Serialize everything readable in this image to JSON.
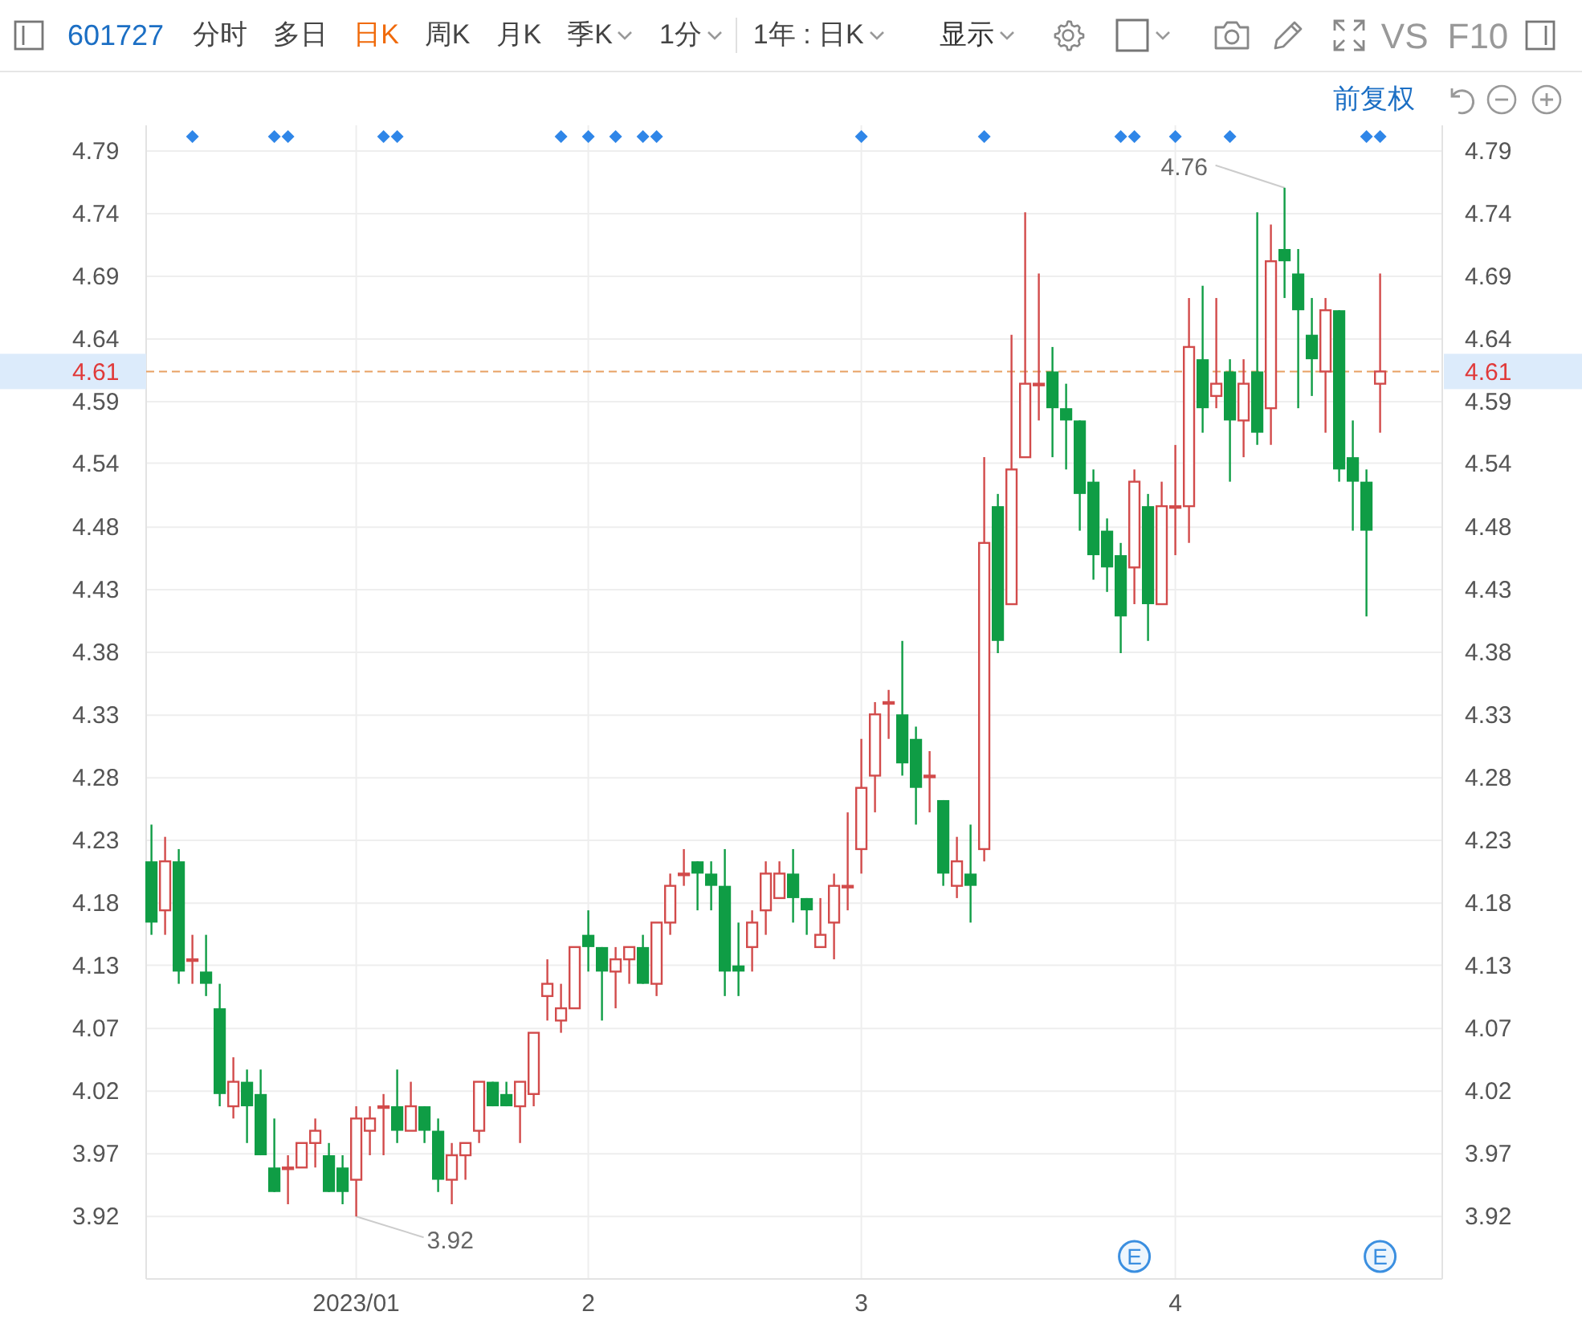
{
  "toolbar": {
    "stock_code": "601727",
    "tabs": [
      {
        "label": "分时",
        "selected": false,
        "dropdown": false
      },
      {
        "label": "多日",
        "selected": false,
        "dropdown": false
      },
      {
        "label": "日K",
        "selected": true,
        "dropdown": false
      },
      {
        "label": "周K",
        "selected": false,
        "dropdown": false
      },
      {
        "label": "月K",
        "selected": false,
        "dropdown": false
      },
      {
        "label": "季K",
        "selected": false,
        "dropdown": true
      },
      {
        "label": "1分",
        "selected": false,
        "dropdown": true
      }
    ],
    "range": "1年 : 日K",
    "display": "显示",
    "compare": "VS",
    "f10": "F10"
  },
  "subbar": {
    "adjust": "前复权"
  },
  "chart": {
    "chart_data": {
      "type": "candlestick",
      "grid": true,
      "ylim": [
        3.869,
        4.811
      ],
      "categories": [
        null,
        null,
        null,
        null,
        null,
        null,
        null,
        null,
        null,
        null,
        null,
        null,
        null,
        null,
        null,
        "2023/01",
        null,
        null,
        null,
        null,
        null,
        null,
        null,
        null,
        null,
        null,
        null,
        null,
        null,
        null,
        null,
        null,
        "2",
        null,
        null,
        null,
        null,
        null,
        null,
        null,
        null,
        null,
        null,
        null,
        null,
        null,
        null,
        null,
        null,
        null,
        null,
        null,
        "3",
        null,
        null,
        null,
        null,
        null,
        null,
        null,
        null,
        null,
        null,
        null,
        null,
        null,
        null,
        null,
        null,
        null,
        null,
        null,
        null,
        null,
        null,
        "4",
        null,
        null,
        null,
        null,
        null,
        null,
        null,
        null,
        null,
        null,
        null,
        null,
        null,
        null,
        null
      ],
      "ohlc": [
        [
          4.21,
          4.24,
          4.15,
          4.16
        ],
        [
          4.17,
          4.23,
          4.15,
          4.21
        ],
        [
          4.21,
          4.22,
          4.11,
          4.12
        ],
        [
          4.13,
          4.15,
          4.11,
          4.13
        ],
        [
          4.12,
          4.15,
          4.1,
          4.11
        ],
        [
          4.09,
          4.11,
          4.01,
          4.02
        ],
        [
          4.01,
          4.05,
          4.0,
          4.03
        ],
        [
          4.03,
          4.04,
          3.98,
          4.01
        ],
        [
          4.02,
          4.04,
          3.97,
          3.97
        ],
        [
          3.96,
          4.0,
          3.94,
          3.94
        ],
        [
          3.96,
          3.97,
          3.93,
          3.96
        ],
        [
          3.96,
          3.98,
          3.96,
          3.98
        ],
        [
          3.98,
          4.0,
          3.96,
          3.99
        ],
        [
          3.97,
          3.98,
          3.94,
          3.94
        ],
        [
          3.96,
          3.97,
          3.93,
          3.94
        ],
        [
          3.95,
          4.01,
          3.92,
          4.0
        ],
        [
          3.99,
          4.01,
          3.97,
          4.0
        ],
        [
          4.01,
          4.02,
          3.97,
          4.01
        ],
        [
          4.01,
          4.04,
          3.98,
          3.99
        ],
        [
          3.99,
          4.03,
          3.99,
          4.01
        ],
        [
          4.01,
          4.01,
          3.98,
          3.99
        ],
        [
          3.99,
          4.0,
          3.94,
          3.95
        ],
        [
          3.95,
          3.98,
          3.93,
          3.97
        ],
        [
          3.97,
          3.98,
          3.95,
          3.98
        ],
        [
          3.99,
          4.03,
          3.98,
          4.03
        ],
        [
          4.03,
          4.03,
          4.01,
          4.01
        ],
        [
          4.02,
          4.03,
          4.01,
          4.01
        ],
        [
          4.01,
          4.03,
          3.98,
          4.03
        ],
        [
          4.02,
          4.07,
          4.01,
          4.07
        ],
        [
          4.1,
          4.13,
          4.08,
          4.11
        ],
        [
          4.08,
          4.11,
          4.07,
          4.09
        ],
        [
          4.09,
          4.14,
          4.09,
          4.14
        ],
        [
          4.15,
          4.17,
          4.12,
          4.14
        ],
        [
          4.14,
          4.14,
          4.08,
          4.12
        ],
        [
          4.12,
          4.14,
          4.09,
          4.13
        ],
        [
          4.13,
          4.14,
          4.11,
          4.14
        ],
        [
          4.14,
          4.15,
          4.11,
          4.11
        ],
        [
          4.11,
          4.16,
          4.1,
          4.16
        ],
        [
          4.16,
          4.2,
          4.15,
          4.19
        ],
        [
          4.2,
          4.22,
          4.19,
          4.2
        ],
        [
          4.21,
          4.21,
          4.17,
          4.2
        ],
        [
          4.2,
          4.21,
          4.17,
          4.19
        ],
        [
          4.19,
          4.22,
          4.1,
          4.12
        ],
        [
          4.125,
          4.16,
          4.1,
          4.12
        ],
        [
          4.14,
          4.17,
          4.12,
          4.16
        ],
        [
          4.17,
          4.21,
          4.15,
          4.2
        ],
        [
          4.18,
          4.21,
          4.18,
          4.2
        ],
        [
          4.2,
          4.22,
          4.16,
          4.18
        ],
        [
          4.18,
          4.18,
          4.15,
          4.17
        ],
        [
          4.14,
          4.18,
          4.14,
          4.15
        ],
        [
          4.16,
          4.2,
          4.13,
          4.19
        ],
        [
          4.19,
          4.25,
          4.17,
          4.19
        ],
        [
          4.22,
          4.31,
          4.2,
          4.27
        ],
        [
          4.28,
          4.34,
          4.25,
          4.33
        ],
        [
          4.34,
          4.35,
          4.31,
          4.34
        ],
        [
          4.33,
          4.39,
          4.28,
          4.29
        ],
        [
          4.31,
          4.32,
          4.24,
          4.27
        ],
        [
          4.28,
          4.3,
          4.25,
          4.28
        ],
        [
          4.26,
          4.26,
          4.19,
          4.2
        ],
        [
          4.19,
          4.23,
          4.18,
          4.21
        ],
        [
          4.2,
          4.24,
          4.16,
          4.19
        ],
        [
          4.22,
          4.54,
          4.21,
          4.47
        ],
        [
          4.5,
          4.51,
          4.38,
          4.39
        ],
        [
          4.42,
          4.64,
          4.42,
          4.53
        ],
        [
          4.54,
          4.74,
          4.54,
          4.6
        ],
        [
          4.6,
          4.69,
          4.57,
          4.6
        ],
        [
          4.61,
          4.63,
          4.54,
          4.58
        ],
        [
          4.58,
          4.6,
          4.53,
          4.57
        ],
        [
          4.57,
          4.57,
          4.48,
          4.51
        ],
        [
          4.52,
          4.53,
          4.44,
          4.46
        ],
        [
          4.48,
          4.49,
          4.43,
          4.45
        ],
        [
          4.46,
          4.47,
          4.38,
          4.41
        ],
        [
          4.45,
          4.53,
          4.42,
          4.52
        ],
        [
          4.5,
          4.51,
          4.39,
          4.42
        ],
        [
          4.42,
          4.52,
          4.42,
          4.5
        ],
        [
          4.5,
          4.55,
          4.46,
          4.5
        ],
        [
          4.5,
          4.67,
          4.47,
          4.63
        ],
        [
          4.62,
          4.68,
          4.56,
          4.58
        ],
        [
          4.59,
          4.67,
          4.58,
          4.6
        ],
        [
          4.61,
          4.62,
          4.52,
          4.57
        ],
        [
          4.57,
          4.62,
          4.54,
          4.6
        ],
        [
          4.61,
          4.74,
          4.55,
          4.56
        ],
        [
          4.58,
          4.73,
          4.55,
          4.7
        ],
        [
          4.71,
          4.76,
          4.67,
          4.7
        ],
        [
          4.69,
          4.71,
          4.58,
          4.66
        ],
        [
          4.64,
          4.67,
          4.59,
          4.62
        ],
        [
          4.61,
          4.67,
          4.56,
          4.66
        ],
        [
          4.66,
          4.66,
          4.52,
          4.53
        ],
        [
          4.54,
          4.57,
          4.48,
          4.52
        ],
        [
          4.52,
          4.53,
          4.41,
          4.48
        ],
        [
          4.6,
          4.69,
          4.56,
          4.61
        ]
      ],
      "yticks": [
        {
          "value": 4.79,
          "label": "4.79"
        },
        {
          "value": 4.7388,
          "label": "4.74"
        },
        {
          "value": 4.6877,
          "label": "4.69"
        },
        {
          "value": 4.6365,
          "label": "4.64"
        },
        {
          "value": 4.5853,
          "label": "4.59"
        },
        {
          "value": 4.5351,
          "label": "4.54"
        },
        {
          "value": 4.4829,
          "label": "4.48"
        },
        {
          "value": 4.4318,
          "label": "4.43"
        },
        {
          "value": 4.3806,
          "label": "4.38"
        },
        {
          "value": 4.3294,
          "label": "4.33"
        },
        {
          "value": 4.2782,
          "label": "4.28"
        },
        {
          "value": 4.2271,
          "label": "4.23"
        },
        {
          "value": 4.1759,
          "label": "4.18"
        },
        {
          "value": 4.1251,
          "label": "4.13"
        },
        {
          "value": 4.0735,
          "label": "4.07"
        },
        {
          "value": 4.0224,
          "label": "4.02"
        },
        {
          "value": 3.9712,
          "label": "3.97"
        },
        {
          "value": 3.92,
          "label": "3.92"
        }
      ],
      "ref_lines": [
        {
          "axis": "y",
          "value": 4.61,
          "label": "4.61"
        }
      ]
    },
    "candle_notes": [
      {
        "diamond": false
      },
      {
        "diamond": false
      },
      {
        "diamond": false
      },
      {
        "diamond": true
      },
      {
        "diamond": false
      },
      {
        "diamond": false
      },
      {
        "diamond": false
      },
      {
        "diamond": false
      },
      {
        "diamond": false
      },
      {
        "diamond": true
      },
      {
        "diamond": true
      },
      {
        "diamond": false
      },
      {
        "diamond": false
      },
      {
        "diamond": false
      },
      {
        "diamond": false
      },
      {
        "diamond": false,
        "low_label": "3.92"
      },
      {
        "diamond": false
      },
      {
        "diamond": true
      },
      {
        "diamond": true
      },
      {
        "diamond": false
      },
      {
        "diamond": false
      },
      {
        "diamond": false
      },
      {
        "diamond": false
      },
      {
        "diamond": false
      },
      {
        "diamond": false
      },
      {
        "diamond": false
      },
      {
        "diamond": false
      },
      {
        "diamond": false
      },
      {
        "diamond": false
      },
      {
        "diamond": false
      },
      {
        "diamond": true
      },
      {
        "diamond": false
      },
      {
        "diamond": true
      },
      {
        "diamond": false
      },
      {
        "diamond": true
      },
      {
        "diamond": false
      },
      {
        "diamond": true
      },
      {
        "diamond": true
      },
      {
        "diamond": false
      },
      {
        "diamond": false
      },
      {
        "diamond": false
      },
      {
        "diamond": false
      },
      {
        "diamond": false
      },
      {
        "diamond": false
      },
      {
        "diamond": false
      },
      {
        "diamond": false
      },
      {
        "diamond": false
      },
      {
        "diamond": false
      },
      {
        "diamond": false
      },
      {
        "diamond": false
      },
      {
        "diamond": false
      },
      {
        "diamond": false
      },
      {
        "diamond": true
      },
      {
        "diamond": false
      },
      {
        "diamond": false
      },
      {
        "diamond": false
      },
      {
        "diamond": false
      },
      {
        "diamond": false
      },
      {
        "diamond": false
      },
      {
        "diamond": false
      },
      {
        "diamond": false
      },
      {
        "diamond": true
      },
      {
        "diamond": false
      },
      {
        "diamond": false
      },
      {
        "diamond": false
      },
      {
        "diamond": false
      },
      {
        "diamond": false
      },
      {
        "diamond": false
      },
      {
        "diamond": false
      },
      {
        "diamond": false
      },
      {
        "diamond": false
      },
      {
        "diamond": true
      },
      {
        "diamond": true,
        "badge": "E"
      },
      {
        "diamond": false
      },
      {
        "diamond": false
      },
      {
        "diamond": true
      },
      {
        "diamond": false
      },
      {
        "diamond": false
      },
      {
        "diamond": false
      },
      {
        "diamond": true
      },
      {
        "diamond": false
      },
      {
        "diamond": false
      },
      {
        "diamond": false
      },
      {
        "diamond": false,
        "high_label": "4.76"
      },
      {
        "diamond": false
      },
      {
        "diamond": false
      },
      {
        "diamond": false
      },
      {
        "diamond": false
      },
      {
        "diamond": false
      },
      {
        "diamond": true
      },
      {
        "diamond": true,
        "badge": "E"
      }
    ]
  }
}
